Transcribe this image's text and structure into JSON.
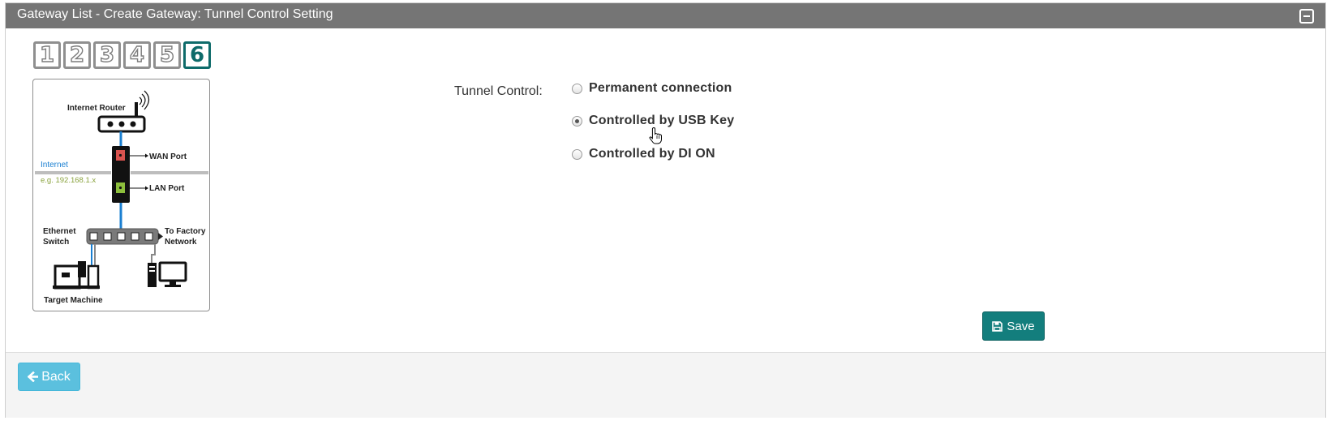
{
  "header": {
    "title": "Gateway List - Create Gateway: Tunnel Control Setting"
  },
  "steps": [
    "1",
    "2",
    "3",
    "4",
    "5",
    "6"
  ],
  "active_step": "6",
  "diagram": {
    "router_label": "Internet Router",
    "wan_label": "WAN Port",
    "lan_label": "LAN Port",
    "internet_label": "Internet",
    "ip_label": "e.g. 192.168.1.x",
    "switch_label_1": "Ethernet",
    "switch_label_2": "Switch",
    "factory_label_1": "To Factory",
    "factory_label_2": "Network",
    "machine_label": "Target Machine"
  },
  "form": {
    "label": "Tunnel Control:",
    "options": [
      {
        "label": "Permanent connection",
        "checked": false
      },
      {
        "label": "Controlled by USB Key",
        "checked": true
      },
      {
        "label": "Controlled by DI ON",
        "checked": false
      }
    ]
  },
  "buttons": {
    "save": "Save",
    "back": "Back"
  },
  "colors": {
    "header": "#757575",
    "primary": "#137e7d",
    "info": "#5bc0de",
    "accent": "#0e6b6a"
  }
}
